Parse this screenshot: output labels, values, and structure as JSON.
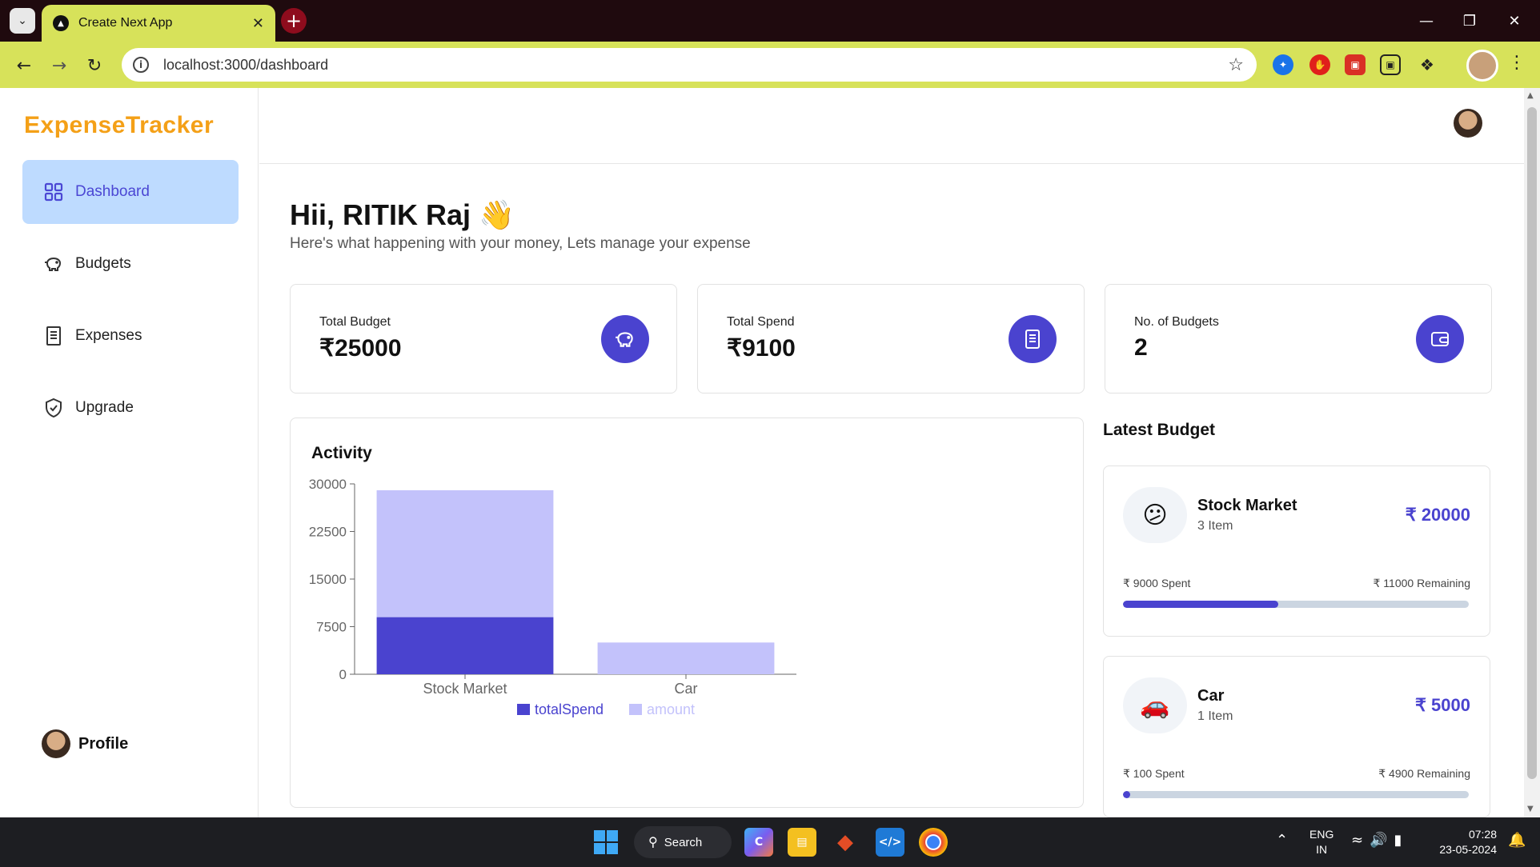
{
  "browser": {
    "tab_title": "Create Next App",
    "url": "localhost:3000/dashboard"
  },
  "app": {
    "logo": "ExpenseTracker",
    "sidebar": {
      "items": [
        {
          "label": "Dashboard",
          "icon": "grid-icon",
          "active": true
        },
        {
          "label": "Budgets",
          "icon": "piggy-bank-icon",
          "active": false
        },
        {
          "label": "Expenses",
          "icon": "receipt-icon",
          "active": false
        },
        {
          "label": "Upgrade",
          "icon": "shield-check-icon",
          "active": false
        }
      ],
      "profile_label": "Profile"
    },
    "greeting": "Hii, RITIK Raj 👋",
    "subtitle": "Here's what happening with your money, Lets manage your expense",
    "stats": [
      {
        "label": "Total Budget",
        "value": "₹25000",
        "icon": "piggy-bank-icon"
      },
      {
        "label": "Total Spend",
        "value": "₹9100",
        "icon": "receipt-icon"
      },
      {
        "label": "No. of Budgets",
        "value": "2",
        "icon": "wallet-icon"
      }
    ],
    "activity_title": "Activity",
    "latest_title": "Latest Budget",
    "budgets": [
      {
        "emoji": "😕",
        "name": "Stock Market",
        "items": "3 Item",
        "amount": "₹ 20000",
        "spent": "₹ 9000 Spent",
        "remaining": "₹ 11000 Remaining",
        "progress": 0.45
      },
      {
        "emoji": "🚗",
        "name": "Car",
        "items": "1 Item",
        "amount": "₹ 5000",
        "spent": "₹ 100 Spent",
        "remaining": "₹ 4900 Remaining",
        "progress": 0.02
      }
    ],
    "colors": {
      "accent": "#4a43cf",
      "accent_light": "#c3c2fb",
      "logo": "#f4a017",
      "active_nav": "#bedbff"
    }
  },
  "chart_data": {
    "type": "bar",
    "stacked": true,
    "categories": [
      "Stock Market",
      "Car"
    ],
    "series": [
      {
        "name": "totalSpend",
        "values": [
          9000,
          0
        ],
        "color": "#4a43cf"
      },
      {
        "name": "amount",
        "values": [
          20000,
          5000
        ],
        "color": "#c3c2fb"
      }
    ],
    "y_ticks": [
      0,
      7500,
      15000,
      22500,
      30000
    ],
    "ylim": [
      0,
      30000
    ],
    "legend_position": "bottom-center"
  },
  "taskbar": {
    "search_label": "Search",
    "lang_line1": "ENG",
    "lang_line2": "IN",
    "time": "07:28",
    "date": "23-05-2024"
  }
}
